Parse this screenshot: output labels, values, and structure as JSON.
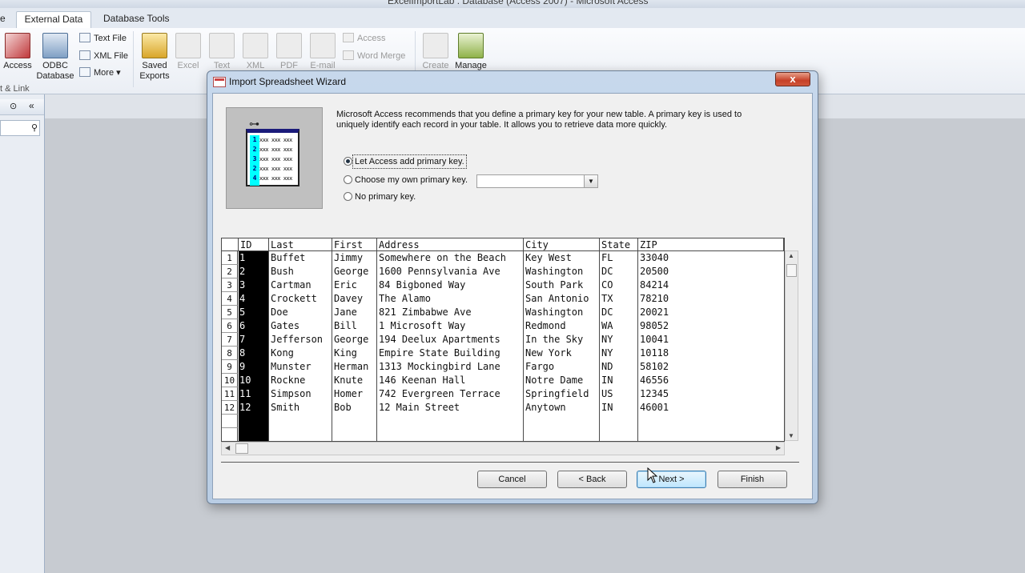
{
  "app": {
    "title": "ExcelImportLab : Database (Access 2007) - Microsoft Access",
    "tabs": [
      "e",
      "External Data",
      "Database Tools"
    ],
    "active_tab": "External Data"
  },
  "ribbon": {
    "import": {
      "access": "Access",
      "odbc": "ODBC Database",
      "text_file": "Text File",
      "xml_file": "XML File",
      "more": "More ▾",
      "group_label": "t & Link"
    },
    "export": {
      "saved_exports": "Saved Exports",
      "excel": "Excel",
      "text": "Text",
      "xml": "XML",
      "pdf": "PDF",
      "email": "E-mail",
      "access": "Access",
      "word_merge": "Word Merge"
    },
    "collect": {
      "create": "Create",
      "manage": "Manage"
    }
  },
  "dialog": {
    "title": "Import Spreadsheet Wizard",
    "close_glyph": "x",
    "description": "Microsoft Access recommends that you define a primary key for your new table. A primary key is used to uniquely identify each record in your table. It allows you to retrieve data more quickly.",
    "options": {
      "let_access": "Let Access add primary key.",
      "choose_own": "Choose my own primary key.",
      "no_key": "No primary key."
    },
    "selected_option": "let_access",
    "illustration_rows": [
      "1",
      "2",
      "3",
      "2",
      "4"
    ],
    "illustration_cell_text": "xxx xxx xxx",
    "buttons": {
      "cancel": "Cancel",
      "back": "< Back",
      "next": "Next >",
      "finish": "Finish"
    }
  },
  "grid": {
    "columns": [
      "ID",
      "Last",
      "First",
      "Address",
      "City",
      "State",
      "ZIP"
    ],
    "rows": [
      [
        "1",
        "Buffet",
        "Jimmy",
        "Somewhere on the Beach",
        "Key West",
        "FL",
        "33040"
      ],
      [
        "2",
        "Bush",
        "George",
        "1600 Pennsylvania Ave",
        "Washington",
        "DC",
        "20500"
      ],
      [
        "3",
        "Cartman",
        "Eric",
        "84 Bigboned Way",
        "South Park",
        "CO",
        "84214"
      ],
      [
        "4",
        "Crockett",
        "Davey",
        "The Alamo",
        "San Antonio",
        "TX",
        "78210"
      ],
      [
        "5",
        "Doe",
        "Jane",
        "821 Zimbabwe Ave",
        "Washington",
        "DC",
        "20021"
      ],
      [
        "6",
        "Gates",
        "Bill",
        "1 Microsoft Way",
        "Redmond",
        "WA",
        "98052"
      ],
      [
        "7",
        "Jefferson",
        "George",
        "194 Deelux Apartments",
        "In the Sky",
        "NY",
        "10041"
      ],
      [
        "8",
        "Kong",
        "King",
        "Empire State Building",
        "New York",
        "NY",
        "10118"
      ],
      [
        "9",
        "Munster",
        "Herman",
        "1313 Mockingbird Lane",
        "Fargo",
        "ND",
        "58102"
      ],
      [
        "10",
        "Rockne",
        "Knute",
        "146 Keenan Hall",
        "Notre Dame",
        "IN",
        "46556"
      ],
      [
        "11",
        "Simpson",
        "Homer",
        "742 Evergreen Terrace",
        "Springfield",
        "US",
        "12345"
      ],
      [
        "12",
        "Smith",
        "Bob",
        "12 Main Street",
        "Anytown",
        "IN",
        "46001"
      ]
    ]
  }
}
